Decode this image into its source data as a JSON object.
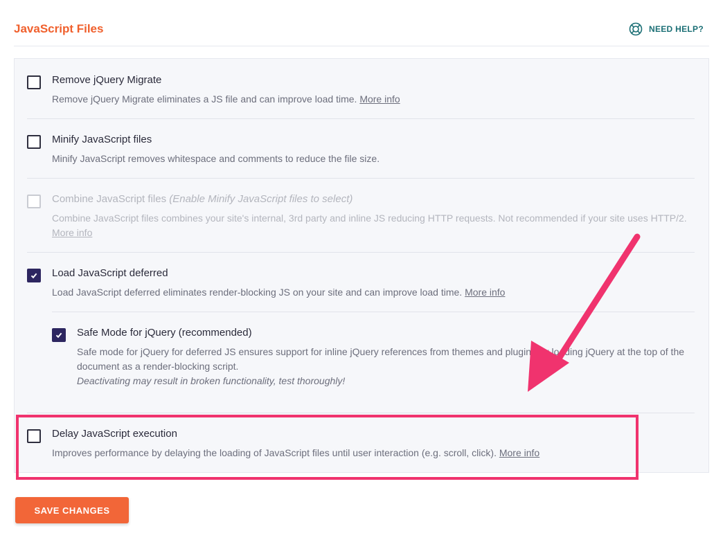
{
  "header": {
    "title": "JavaScript Files",
    "help_label": "NEED HELP?",
    "help_icon": "lifebuoy-icon"
  },
  "options": [
    {
      "label": "Remove jQuery Migrate",
      "checked": false,
      "disabled": false,
      "description": "Remove jQuery Migrate eliminates a JS file and can improve load time.",
      "link": "More info"
    },
    {
      "label": "Minify JavaScript files",
      "checked": false,
      "disabled": false,
      "description": "Minify JavaScript removes whitespace and comments to reduce the file size."
    },
    {
      "label": "Combine JavaScript files",
      "label_note": "(Enable Minify JavaScript files to select)",
      "checked": false,
      "disabled": true,
      "description": "Combine JavaScript files combines your site's internal, 3rd party and inline JS reducing HTTP requests. Not recommended if your site uses HTTP/2.",
      "link": "More info"
    },
    {
      "label": "Load JavaScript deferred",
      "checked": true,
      "disabled": false,
      "description": "Load JavaScript deferred eliminates render-blocking JS on your site and can improve load time.",
      "link": "More info"
    },
    {
      "label": "Safe Mode for jQuery (recommended)",
      "checked": true,
      "disabled": false,
      "description": "Safe mode for jQuery for deferred JS ensures support for inline jQuery references from themes and plugins by loading jQuery at the top of the document as a render-blocking script.",
      "warning": "Deactivating may result in broken functionality, test thoroughly!"
    },
    {
      "label": "Delay JavaScript execution",
      "checked": false,
      "disabled": false,
      "description": "Improves performance by delaying the loading of JavaScript files until user interaction (e.g. scroll, click).",
      "link": "More info"
    }
  ],
  "save_button": "SAVE CHANGES",
  "colors": {
    "accent": "#f0602d",
    "help": "#1b6f75",
    "checkbox_checked": "#2d2660",
    "highlight": "#f0336e",
    "button": "#f26638"
  }
}
